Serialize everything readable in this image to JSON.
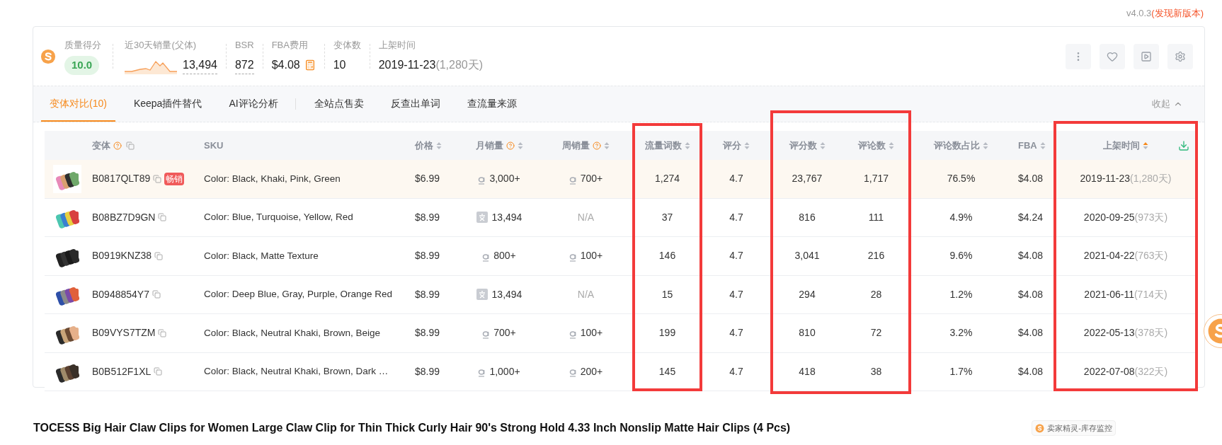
{
  "version": {
    "number": "v4.0.3",
    "notice": "(发现新版本)"
  },
  "stats": [
    {
      "kind": "badge",
      "label": "质量得分",
      "value": "10.0"
    },
    {
      "kind": "sparkline",
      "label": "近30天销量(父体)",
      "value": "13,494"
    },
    {
      "kind": "underlined",
      "label": "BSR",
      "value": "872"
    },
    {
      "kind": "calculator",
      "label": "FBA费用",
      "value": "$4.08"
    },
    {
      "kind": "plain",
      "label": "变体数",
      "value": "10"
    },
    {
      "kind": "date",
      "label": "上架时间",
      "value": "2019-11-23",
      "suffix": "(1,280天)"
    }
  ],
  "tabs": [
    {
      "label": "变体对比(10)",
      "selected": true
    },
    {
      "label": "Keepa插件替代",
      "selected": false
    },
    {
      "label": "AI评论分析",
      "selected": false
    },
    {
      "label": "全站点售卖",
      "selected": false
    },
    {
      "label": "反查出单词",
      "selected": false
    },
    {
      "label": "查流量来源",
      "selected": false
    }
  ],
  "collapse": "收起",
  "table": {
    "columns": [
      {
        "label": "变体",
        "help": true,
        "copy": true
      },
      {
        "label": "SKU"
      },
      {
        "label": "价格",
        "sorted": false
      },
      {
        "label": "月销量",
        "help": true,
        "sorted": false
      },
      {
        "label": "周销量",
        "help": true,
        "sorted": false
      },
      {
        "label": "流量词数",
        "sorted": false
      },
      {
        "label": "评分",
        "sorted": false
      },
      {
        "label": "评分数",
        "sorted": false
      },
      {
        "label": "评论数",
        "sorted": false
      },
      {
        "label": "评论数占比",
        "sorted": false
      },
      {
        "label": "FBA",
        "sorted": false
      },
      {
        "label": "上架时间",
        "sorted": true
      }
    ],
    "rows": [
      {
        "selected": true,
        "asin": "B0817QLT89",
        "badge": "畅销",
        "sku": "Color: Black, Khaki, Pink, Green",
        "price": "$6.99",
        "monthly": {
          "kind": "amazon",
          "value": "3,000+"
        },
        "weekly": {
          "kind": "amazon",
          "value": "700+"
        },
        "keywords": "1,274",
        "rating": "4.7",
        "ratings": "23,767",
        "reviews": "1,717",
        "ratio": "76.5%",
        "fba": "$4.08",
        "date": "2019-11-23",
        "days": "(1,280天)"
      },
      {
        "selected": false,
        "asin": "B08BZ7D9GN",
        "sku": "Color: Blue, Turquoise, Yellow, Red",
        "price": "$8.99",
        "monthly": {
          "kind": "estimate",
          "value": "13,494"
        },
        "weekly": {
          "kind": "unavailable",
          "value": "N/A"
        },
        "keywords": "37",
        "rating": "4.7",
        "ratings": "816",
        "reviews": "111",
        "ratio": "4.9%",
        "fba": "$4.24",
        "date": "2020-09-25",
        "days": "(973天)"
      },
      {
        "selected": false,
        "asin": "B0919KNZ38",
        "sku": "Color: Black, Matte Texture",
        "price": "$8.99",
        "monthly": {
          "kind": "amazon",
          "value": "800+"
        },
        "weekly": {
          "kind": "amazon",
          "value": "100+"
        },
        "keywords": "146",
        "rating": "4.7",
        "ratings": "3,041",
        "reviews": "216",
        "ratio": "9.6%",
        "fba": "$4.08",
        "date": "2021-04-22",
        "days": "(763天)"
      },
      {
        "selected": false,
        "asin": "B0948854Y7",
        "sku": "Color: Deep Blue, Gray, Purple, Orange Red",
        "price": "$8.99",
        "monthly": {
          "kind": "estimate",
          "value": "13,494"
        },
        "weekly": {
          "kind": "unavailable",
          "value": "N/A"
        },
        "keywords": "15",
        "rating": "4.7",
        "ratings": "294",
        "reviews": "28",
        "ratio": "1.2%",
        "fba": "$4.08",
        "date": "2021-06-11",
        "days": "(714天)"
      },
      {
        "selected": false,
        "asin": "B09VYS7TZM",
        "sku": "Color: Black, Neutral Khaki, Brown, Beige",
        "price": "$8.99",
        "monthly": {
          "kind": "amazon",
          "value": "700+"
        },
        "weekly": {
          "kind": "amazon",
          "value": "100+"
        },
        "keywords": "199",
        "rating": "4.7",
        "ratings": "810",
        "reviews": "72",
        "ratio": "3.2%",
        "fba": "$4.08",
        "date": "2022-05-13",
        "days": "(378天)"
      },
      {
        "selected": false,
        "asin": "B0B512F1XL",
        "sku": "Color: Black, Neutral Khaki, Brown, Dark …",
        "price": "$8.99",
        "monthly": {
          "kind": "amazon",
          "value": "1,000+"
        },
        "weekly": {
          "kind": "amazon",
          "value": "200+"
        },
        "keywords": "145",
        "rating": "4.7",
        "ratings": "418",
        "reviews": "38",
        "ratio": "1.7%",
        "fba": "$4.08",
        "date": "2022-07-08",
        "days": "(322天)"
      }
    ]
  },
  "product_title": "TOCESS Big Hair Claw Clips for Women Large Claw Clip for Thin Thick Curly Hair 90's Strong Hold 4.33 Inch Nonslip Matte Hair Clips (4 Pcs)",
  "monitor_tag": "卖家精灵-库存监控"
}
